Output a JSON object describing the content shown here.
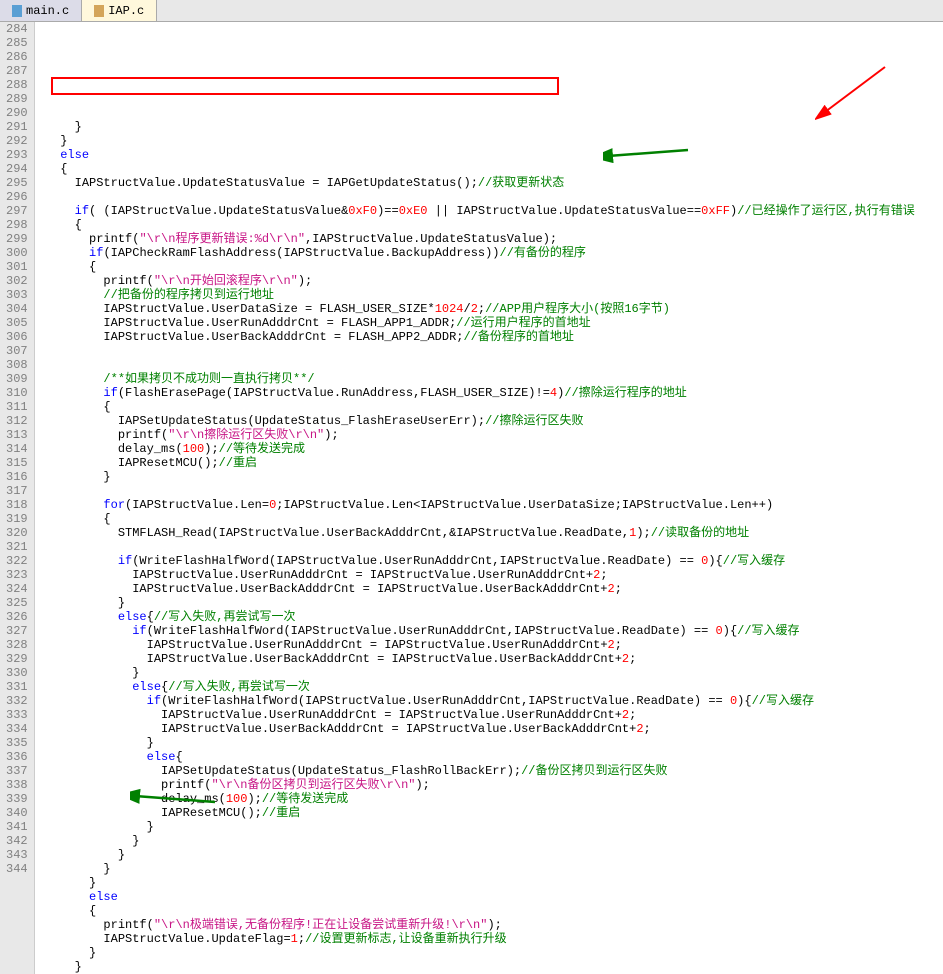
{
  "tabs": [
    {
      "label": "main.c",
      "active": false
    },
    {
      "label": "IAP.c",
      "active": true
    }
  ],
  "gutter": {
    "start": 284,
    "end": 344
  },
  "code": {
    "lines": [
      {
        "n": 284,
        "i": 2,
        "t": [
          [
            "op",
            "}"
          ]
        ]
      },
      {
        "n": 285,
        "i": 1,
        "t": [
          [
            "op",
            "}"
          ]
        ]
      },
      {
        "n": 286,
        "i": 1,
        "t": [
          [
            "kw",
            "else"
          ]
        ]
      },
      {
        "n": 287,
        "i": 1,
        "t": [
          [
            "op",
            "{"
          ]
        ]
      },
      {
        "n": 288,
        "i": 2,
        "t": [
          [
            "id",
            "IAPStructValue.UpdateStatusValue = IAPGetUpdateStatus();"
          ],
          [
            "cmt",
            "//获取更新状态"
          ]
        ]
      },
      {
        "n": 289,
        "i": 0,
        "t": []
      },
      {
        "n": 290,
        "i": 2,
        "t": [
          [
            "kw",
            "if"
          ],
          [
            "op",
            "( (IAPStructValue.UpdateStatusValue&"
          ],
          [
            "num",
            "0xF0"
          ],
          [
            "op",
            ")=="
          ],
          [
            "num",
            "0xE0"
          ],
          [
            "op",
            " || IAPStructValue.UpdateStatusValue=="
          ],
          [
            "num",
            "0xFF"
          ],
          [
            "op",
            ")"
          ],
          [
            "cmt",
            "//已经操作了运行区,执行有错误"
          ]
        ]
      },
      {
        "n": 291,
        "i": 2,
        "t": [
          [
            "op",
            "{"
          ]
        ]
      },
      {
        "n": 292,
        "i": 3,
        "t": [
          [
            "id",
            "printf("
          ],
          [
            "strpink",
            "\"\\r\\n程序更新错误:%d\\r\\n\""
          ],
          [
            "op",
            ",IAPStructValue.UpdateStatusValue);"
          ]
        ]
      },
      {
        "n": 293,
        "i": 3,
        "t": [
          [
            "kw",
            "if"
          ],
          [
            "op",
            "(IAPCheckRamFlashAddress(IAPStructValue.BackupAddress))"
          ],
          [
            "cmt",
            "//有备份的程序"
          ]
        ]
      },
      {
        "n": 294,
        "i": 3,
        "t": [
          [
            "op",
            "{"
          ]
        ]
      },
      {
        "n": 295,
        "i": 4,
        "t": [
          [
            "id",
            "printf("
          ],
          [
            "strpink",
            "\"\\r\\n开始回滚程序\\r\\n\""
          ],
          [
            "op",
            ");"
          ]
        ]
      },
      {
        "n": 296,
        "i": 4,
        "t": [
          [
            "cmt",
            "//把备份的程序拷贝到运行地址"
          ]
        ]
      },
      {
        "n": 297,
        "i": 4,
        "t": [
          [
            "id",
            "IAPStructValue.UserDataSize = FLASH_USER_SIZE*"
          ],
          [
            "num",
            "1024"
          ],
          [
            "op",
            "/"
          ],
          [
            "num",
            "2"
          ],
          [
            "op",
            ";"
          ],
          [
            "cmt",
            "//APP用户程序大小(按照16字节)"
          ]
        ]
      },
      {
        "n": 298,
        "i": 4,
        "t": [
          [
            "id",
            "IAPStructValue.UserRunAdddrCnt = FLASH_APP1_ADDR;"
          ],
          [
            "cmt",
            "//运行用户程序的首地址"
          ]
        ]
      },
      {
        "n": 299,
        "i": 4,
        "t": [
          [
            "id",
            "IAPStructValue.UserBackAdddrCnt = FLASH_APP2_ADDR;"
          ],
          [
            "cmt",
            "//备份程序的首地址"
          ]
        ]
      },
      {
        "n": 300,
        "i": 0,
        "t": []
      },
      {
        "n": 301,
        "i": 0,
        "t": []
      },
      {
        "n": 302,
        "i": 4,
        "t": [
          [
            "cmt",
            "/**如果拷贝不成功则一直执行拷贝**/"
          ]
        ]
      },
      {
        "n": 303,
        "i": 4,
        "t": [
          [
            "kw",
            "if"
          ],
          [
            "op",
            "(FlashErasePage(IAPStructValue.RunAddress,FLASH_USER_SIZE)!="
          ],
          [
            "num",
            "4"
          ],
          [
            "op",
            ")"
          ],
          [
            "cmt",
            "//擦除运行程序的地址"
          ]
        ]
      },
      {
        "n": 304,
        "i": 4,
        "t": [
          [
            "op",
            "{"
          ]
        ]
      },
      {
        "n": 305,
        "i": 5,
        "t": [
          [
            "id",
            "IAPSetUpdateStatus(UpdateStatus_FlashEraseUserErr);"
          ],
          [
            "cmt",
            "//擦除运行区失败"
          ]
        ]
      },
      {
        "n": 306,
        "i": 5,
        "t": [
          [
            "id",
            "printf("
          ],
          [
            "strpink",
            "\"\\r\\n擦除运行区失败\\r\\n\""
          ],
          [
            "op",
            ");"
          ]
        ]
      },
      {
        "n": 307,
        "i": 5,
        "t": [
          [
            "id",
            "delay_ms("
          ],
          [
            "num",
            "100"
          ],
          [
            "op",
            ");"
          ],
          [
            "cmt",
            "//等待发送完成"
          ]
        ]
      },
      {
        "n": 308,
        "i": 5,
        "t": [
          [
            "id",
            "IAPResetMCU();"
          ],
          [
            "cmt",
            "//重启"
          ]
        ]
      },
      {
        "n": 309,
        "i": 4,
        "t": [
          [
            "op",
            "}"
          ]
        ]
      },
      {
        "n": 310,
        "i": 0,
        "t": []
      },
      {
        "n": 311,
        "i": 4,
        "t": [
          [
            "kw",
            "for"
          ],
          [
            "op",
            "(IAPStructValue.Len="
          ],
          [
            "num",
            "0"
          ],
          [
            "op",
            ";IAPStructValue.Len<IAPStructValue.UserDataSize;IAPStructValue.Len++)"
          ]
        ]
      },
      {
        "n": 312,
        "i": 4,
        "t": [
          [
            "op",
            "{"
          ]
        ]
      },
      {
        "n": 313,
        "i": 5,
        "t": [
          [
            "id",
            "STMFLASH_Read(IAPStructValue.UserBackAdddrCnt,&IAPStructValue.ReadDate,"
          ],
          [
            "num",
            "1"
          ],
          [
            "op",
            ");"
          ],
          [
            "cmt",
            "//读取备份的地址"
          ]
        ]
      },
      {
        "n": 314,
        "i": 0,
        "t": []
      },
      {
        "n": 315,
        "i": 5,
        "t": [
          [
            "kw",
            "if"
          ],
          [
            "op",
            "(WriteFlashHalfWord(IAPStructValue.UserRunAdddrCnt,IAPStructValue.ReadDate) == "
          ],
          [
            "num",
            "0"
          ],
          [
            "op",
            "){"
          ],
          [
            "cmt",
            "//写入缓存"
          ]
        ]
      },
      {
        "n": 316,
        "i": 6,
        "t": [
          [
            "id",
            "IAPStructValue.UserRunAdddrCnt = IAPStructValue.UserRunAdddrCnt+"
          ],
          [
            "num",
            "2"
          ],
          [
            "op",
            ";"
          ]
        ]
      },
      {
        "n": 317,
        "i": 6,
        "t": [
          [
            "id",
            "IAPStructValue.UserBackAdddrCnt = IAPStructValue.UserBackAdddrCnt+"
          ],
          [
            "num",
            "2"
          ],
          [
            "op",
            ";"
          ]
        ]
      },
      {
        "n": 318,
        "i": 5,
        "t": [
          [
            "op",
            "}"
          ]
        ]
      },
      {
        "n": 319,
        "i": 5,
        "t": [
          [
            "kw",
            "else"
          ],
          [
            "op",
            "{"
          ],
          [
            "cmt",
            "//写入失败,再尝试写一次"
          ]
        ]
      },
      {
        "n": 320,
        "i": 6,
        "t": [
          [
            "kw",
            "if"
          ],
          [
            "op",
            "(WriteFlashHalfWord(IAPStructValue.UserRunAdddrCnt,IAPStructValue.ReadDate) == "
          ],
          [
            "num",
            "0"
          ],
          [
            "op",
            "){"
          ],
          [
            "cmt",
            "//写入缓存"
          ]
        ]
      },
      {
        "n": 321,
        "i": 7,
        "t": [
          [
            "id",
            "IAPStructValue.UserRunAdddrCnt = IAPStructValue.UserRunAdddrCnt+"
          ],
          [
            "num",
            "2"
          ],
          [
            "op",
            ";"
          ]
        ]
      },
      {
        "n": 322,
        "i": 7,
        "t": [
          [
            "id",
            "IAPStructValue.UserBackAdddrCnt = IAPStructValue.UserBackAdddrCnt+"
          ],
          [
            "num",
            "2"
          ],
          [
            "op",
            ";"
          ]
        ]
      },
      {
        "n": 323,
        "i": 6,
        "t": [
          [
            "op",
            "}"
          ]
        ]
      },
      {
        "n": 324,
        "i": 6,
        "t": [
          [
            "kw",
            "else"
          ],
          [
            "op",
            "{"
          ],
          [
            "cmt",
            "//写入失败,再尝试写一次"
          ]
        ]
      },
      {
        "n": 325,
        "i": 7,
        "t": [
          [
            "kw",
            "if"
          ],
          [
            "op",
            "(WriteFlashHalfWord(IAPStructValue.UserRunAdddrCnt,IAPStructValue.ReadDate) == "
          ],
          [
            "num",
            "0"
          ],
          [
            "op",
            "){"
          ],
          [
            "cmt",
            "//写入缓存"
          ]
        ]
      },
      {
        "n": 326,
        "i": 8,
        "t": [
          [
            "id",
            "IAPStructValue.UserRunAdddrCnt = IAPStructValue.UserRunAdddrCnt+"
          ],
          [
            "num",
            "2"
          ],
          [
            "op",
            ";"
          ]
        ]
      },
      {
        "n": 327,
        "i": 8,
        "t": [
          [
            "id",
            "IAPStructValue.UserBackAdddrCnt = IAPStructValue.UserBackAdddrCnt+"
          ],
          [
            "num",
            "2"
          ],
          [
            "op",
            ";"
          ]
        ]
      },
      {
        "n": 328,
        "i": 7,
        "t": [
          [
            "op",
            "}"
          ]
        ]
      },
      {
        "n": 329,
        "i": 7,
        "t": [
          [
            "kw",
            "else"
          ],
          [
            "op",
            "{"
          ]
        ]
      },
      {
        "n": 330,
        "i": 8,
        "t": [
          [
            "id",
            "IAPSetUpdateStatus(UpdateStatus_FlashRollBackErr);"
          ],
          [
            "cmt",
            "//备份区拷贝到运行区失败"
          ]
        ]
      },
      {
        "n": 331,
        "i": 8,
        "t": [
          [
            "id",
            "printf("
          ],
          [
            "strpink",
            "\"\\r\\n备份区拷贝到运行区失败\\r\\n\""
          ],
          [
            "op",
            ");"
          ]
        ]
      },
      {
        "n": 332,
        "i": 8,
        "t": [
          [
            "id",
            "delay_ms("
          ],
          [
            "num",
            "100"
          ],
          [
            "op",
            ");"
          ],
          [
            "cmt",
            "//等待发送完成"
          ]
        ]
      },
      {
        "n": 333,
        "i": 8,
        "t": [
          [
            "id",
            "IAPResetMCU();"
          ],
          [
            "cmt",
            "//重启"
          ]
        ]
      },
      {
        "n": 334,
        "i": 7,
        "t": [
          [
            "op",
            "}"
          ]
        ]
      },
      {
        "n": 335,
        "i": 6,
        "t": [
          [
            "op",
            "}"
          ]
        ]
      },
      {
        "n": 336,
        "i": 5,
        "t": [
          [
            "op",
            "}"
          ]
        ]
      },
      {
        "n": 337,
        "i": 4,
        "t": [
          [
            "op",
            "}"
          ]
        ]
      },
      {
        "n": 338,
        "i": 3,
        "t": [
          [
            "op",
            "}"
          ]
        ]
      },
      {
        "n": 339,
        "i": 3,
        "t": [
          [
            "kw",
            "else"
          ]
        ]
      },
      {
        "n": 340,
        "i": 3,
        "t": [
          [
            "op",
            "{"
          ]
        ]
      },
      {
        "n": 341,
        "i": 4,
        "t": [
          [
            "id",
            "printf("
          ],
          [
            "strpink",
            "\"\\r\\n极端错误,无备份程序!正在让设备尝试重新升级!\\r\\n\""
          ],
          [
            "op",
            ");"
          ]
        ]
      },
      {
        "n": 342,
        "i": 4,
        "t": [
          [
            "id",
            "IAPStructValue.UpdateFlag="
          ],
          [
            "num",
            "1"
          ],
          [
            "op",
            ";"
          ],
          [
            "cmt",
            "//设置更新标志,让设备重新执行升级"
          ]
        ]
      },
      {
        "n": 343,
        "i": 3,
        "t": [
          [
            "op",
            "}"
          ]
        ]
      },
      {
        "n": 344,
        "i": 2,
        "t": [
          [
            "op",
            "}"
          ]
        ]
      }
    ]
  },
  "annotations": {
    "highlight_box": {
      "line": 288
    },
    "red_arrow": {
      "near_line": 290,
      "side": "right"
    },
    "green_arrows": [
      {
        "line": 293
      },
      {
        "line": 339
      }
    ]
  }
}
